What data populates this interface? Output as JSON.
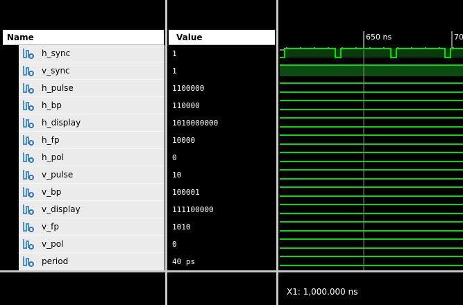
{
  "headers": {
    "name": "Name",
    "value": "Value"
  },
  "signals": [
    {
      "name": "h_sync",
      "value": "1",
      "kind": "logic-input"
    },
    {
      "name": "v_sync",
      "value": "1",
      "kind": "logic-input"
    },
    {
      "name": "h_pulse",
      "value": "1100000",
      "kind": "bus"
    },
    {
      "name": "h_bp",
      "value": "110000",
      "kind": "bus"
    },
    {
      "name": "h_display",
      "value": "1010000000",
      "kind": "bus"
    },
    {
      "name": "h_fp",
      "value": "10000",
      "kind": "bus"
    },
    {
      "name": "h_pol",
      "value": "0",
      "kind": "bus"
    },
    {
      "name": "v_pulse",
      "value": "10",
      "kind": "bus"
    },
    {
      "name": "v_bp",
      "value": "100001",
      "kind": "bus"
    },
    {
      "name": "v_display",
      "value": "111100000",
      "kind": "bus"
    },
    {
      "name": "v_fp",
      "value": "1010",
      "kind": "bus"
    },
    {
      "name": "v_pol",
      "value": "0",
      "kind": "bus"
    },
    {
      "name": "period",
      "value": "40 ps",
      "kind": "bus"
    }
  ],
  "timeline": {
    "labels": [
      "650 ns",
      "70"
    ]
  },
  "cursor": {
    "readout": "X1: 1,000.000 ns"
  },
  "colors": {
    "wave": "#00e000",
    "bus_fill": "#0a3a0a",
    "icon_blue": "#2e74c9",
    "row_bg": "#ebebeb"
  },
  "icons": {
    "signal_icon": "waveform-signal-icon"
  }
}
